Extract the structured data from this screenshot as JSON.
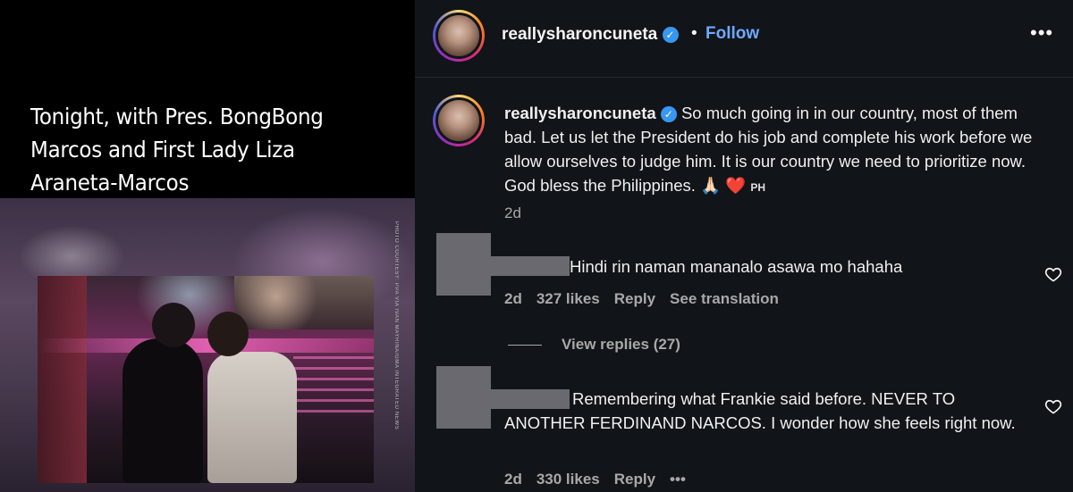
{
  "media": {
    "overlay_text": "Tonight, with Pres. BongBong Marcos and First Lady Liza Araneta-Marcos",
    "overlay_emoji": "🙏🏻",
    "photo_credit": "PHOTO COURTESY: PPA VIA IVAN MAYRINA/GMA INTEGRATED NEWS"
  },
  "header": {
    "username": "reallysharoncuneta",
    "separator": "•",
    "follow_label": "Follow",
    "more_label": "•••"
  },
  "caption": {
    "username": "reallysharoncuneta",
    "text": "So much going in in our country, most of them bad. Let us let the President do his job and complete his work before we allow ourselves to judge him. It is our country we need to prioritize now. God bless the Philippines.",
    "emoji": "🙏🏻",
    "heart": "❤️",
    "flag": "PH",
    "time": "2d"
  },
  "comments": [
    {
      "text": "Hindi rin naman mananalo asawa mo hahaha",
      "time": "2d",
      "likes": "327 likes",
      "reply": "Reply",
      "translation": "See translation"
    },
    {
      "text": "Remembering what Frankie said before. NEVER TO ANOTHER FERDINAND NARCOS. I wonder how she feels right now.",
      "time": "2d",
      "likes": "330 likes",
      "reply": "Reply",
      "more": "•••"
    }
  ],
  "view_replies": "View replies (27)",
  "colors": {
    "panel_bg": "#111418",
    "link_blue": "#6fa8ff",
    "verified_blue": "#3897f0",
    "muted_text": "#a8a8a8"
  }
}
